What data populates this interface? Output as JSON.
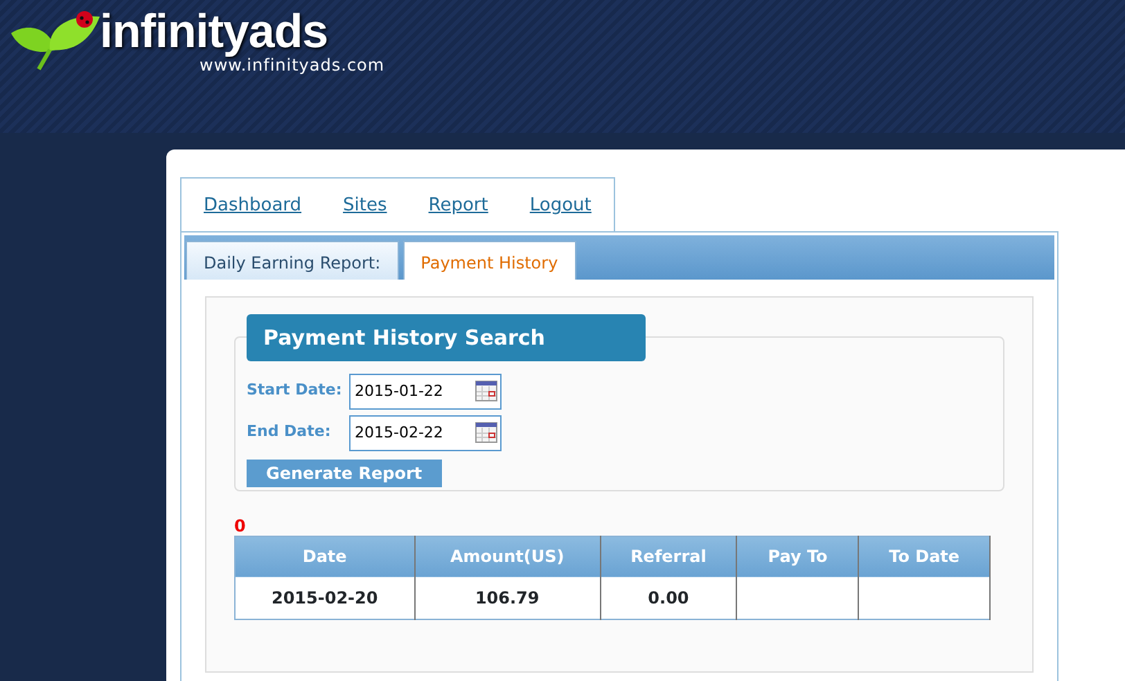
{
  "logo": {
    "name": "infinityads",
    "url": "www.infinityads.com"
  },
  "nav": [
    {
      "label": "Dashboard"
    },
    {
      "label": "Sites"
    },
    {
      "label": "Report"
    },
    {
      "label": "Logout"
    }
  ],
  "tabs": [
    {
      "label": "Daily Earning Report:",
      "selected": false
    },
    {
      "label": "Payment History",
      "selected": true
    }
  ],
  "search": {
    "title": "Payment History Search",
    "fields": [
      {
        "label": "Start Date:",
        "value": "2015-01-22"
      },
      {
        "label": "End Date:",
        "value": "2015-02-22"
      }
    ],
    "button": "Generate Report"
  },
  "count": "0",
  "table": {
    "columns": [
      "Date",
      "Amount(US)",
      "Referral",
      "Pay To",
      "To Date"
    ],
    "rows": [
      [
        "2015-02-20",
        "106.79",
        "0.00",
        "",
        ""
      ]
    ]
  }
}
